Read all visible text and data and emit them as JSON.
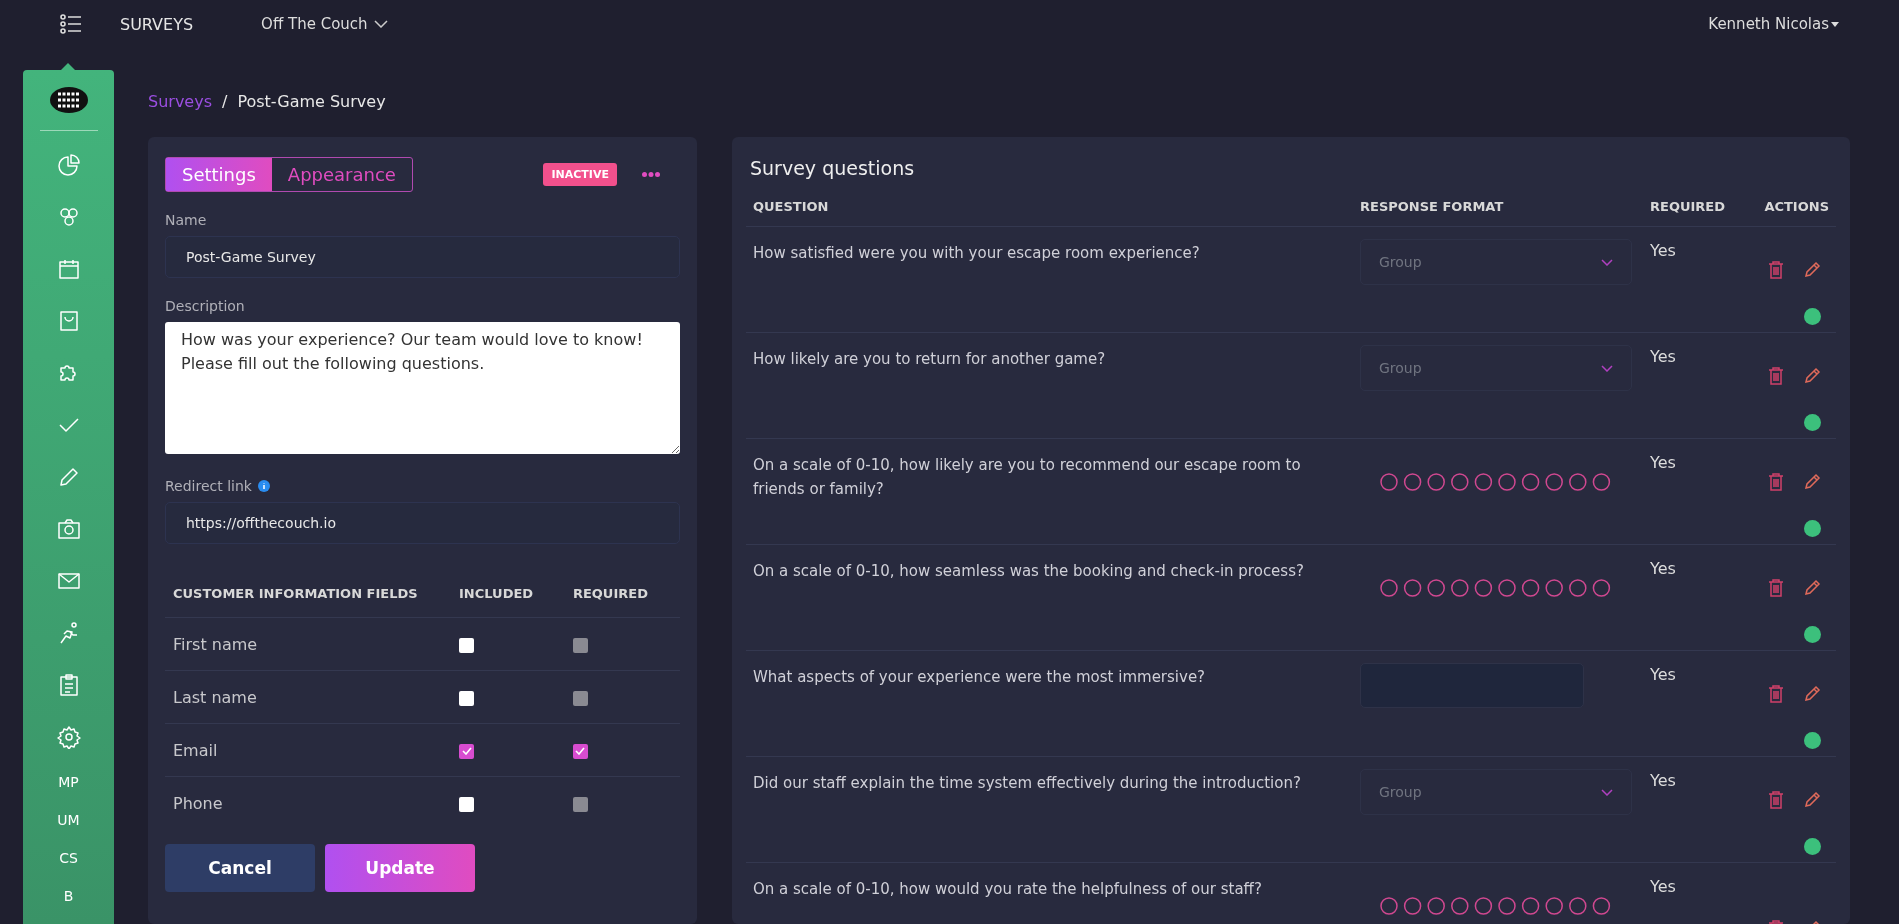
{
  "top_bar": {
    "section_title": "SURVEYS",
    "venue_selector": "Off The Couch",
    "user_name": "Kenneth Nicolas"
  },
  "sidebar": {
    "text_items": [
      "MP",
      "UM",
      "CS",
      "B"
    ]
  },
  "breadcrumb": {
    "parent": "Surveys",
    "separator": "/",
    "current": "Post-Game Survey"
  },
  "settings_panel": {
    "tabs": [
      {
        "label": "Settings",
        "selected": true
      },
      {
        "label": "Appearance",
        "selected": false
      }
    ],
    "status_badge": "INACTIVE",
    "name_label": "Name",
    "name_value": "Post-Game Survey",
    "description_label": "Description",
    "description_value": "How was your experience? Our team would love to know! Please fill out the following questions.",
    "redirect_label": "Redirect link",
    "redirect_value": "https://offthecouch.io",
    "fields_table": {
      "columns": [
        "CUSTOMER INFORMATION FIELDS",
        "INCLUDED",
        "REQUIRED"
      ],
      "rows": [
        {
          "name": "First name",
          "included": false,
          "required": false,
          "required_disabled": true
        },
        {
          "name": "Last name",
          "included": false,
          "required": false,
          "required_disabled": true
        },
        {
          "name": "Email",
          "included": true,
          "required": true,
          "required_disabled": false
        },
        {
          "name": "Phone",
          "included": false,
          "required": false,
          "required_disabled": true
        }
      ]
    },
    "buttons": {
      "cancel": "Cancel",
      "update": "Update"
    }
  },
  "questions_panel": {
    "title": "Survey questions",
    "columns": [
      "QUESTION",
      "RESPONSE FORMAT",
      "REQUIRED",
      "ACTIONS"
    ],
    "rows": [
      {
        "question": "How satisfied were you with your escape room experience?",
        "kind": "dropdown",
        "placeholder": "Group",
        "required": "Yes",
        "active": true
      },
      {
        "question": "How likely are you to return for another game?",
        "kind": "dropdown",
        "placeholder": "Group",
        "required": "Yes",
        "active": true
      },
      {
        "question": "On a scale of 0-10, how likely are you to recommend our escape room to friends or family?",
        "kind": "scale",
        "required": "Yes",
        "active": true
      },
      {
        "question": "On a scale of 0-10, how seamless was the booking and check-in process?",
        "kind": "scale",
        "required": "Yes",
        "active": true
      },
      {
        "question": "What aspects of your experience were the most immersive?",
        "kind": "text",
        "required": "Yes",
        "active": true
      },
      {
        "question": "Did our staff explain the time system effectively during the introduction?",
        "kind": "dropdown",
        "placeholder": "Group",
        "required": "Yes",
        "active": true
      },
      {
        "question": "On a scale of 0-10, how would you rate the helpfulness of our staff?",
        "kind": "scale",
        "required": "Yes"
      }
    ]
  }
}
